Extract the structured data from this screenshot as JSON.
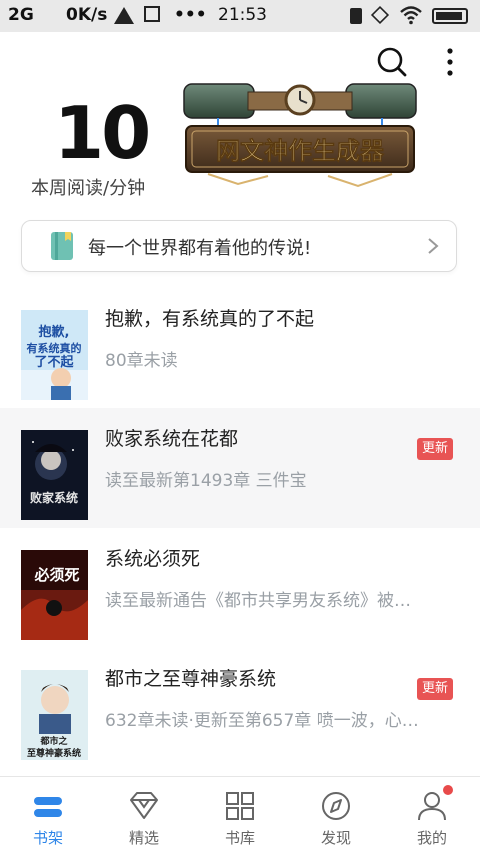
{
  "status_bar": {
    "network": "2G",
    "speed": "0K/s",
    "more": "•••",
    "time": "21:53"
  },
  "header": {
    "reading_minutes": "10",
    "reading_label": "本周阅读/分钟",
    "banner_text": "网文神作生成器"
  },
  "slogan": {
    "text": "每一个世界都有着他的传说!"
  },
  "books": [
    {
      "title": "抱歉，有系统真的了不起",
      "subtitle": "80章未读",
      "badge": "",
      "cover_text": "抱歉有系统真的了不起"
    },
    {
      "title": "败家系统在花都",
      "subtitle": "读至最新第1493章 三件宝",
      "badge": "更新",
      "cover_text": "败家系统"
    },
    {
      "title": "系统必须死",
      "subtitle": "读至最新通告《都市共享男友系统》被…",
      "badge": "",
      "cover_text": "系统必须死"
    },
    {
      "title": "都市之至尊神豪系统",
      "subtitle": "632章未读·更新至第657章 喷一波，心…",
      "badge": "更新",
      "cover_text": "都市之至尊神豪系统"
    }
  ],
  "bottom_nav": [
    {
      "label": "书架",
      "icon": "bookshelf-icon",
      "active": true
    },
    {
      "label": "精选",
      "icon": "diamond-icon",
      "active": false
    },
    {
      "label": "书库",
      "icon": "grid-icon",
      "active": false
    },
    {
      "label": "发现",
      "icon": "compass-icon",
      "active": false
    },
    {
      "label": "我的",
      "icon": "profile-icon",
      "active": false
    }
  ],
  "colors": {
    "accent": "#2f86e8",
    "badge": "#e85454",
    "subtitle": "#9aa0a6"
  }
}
